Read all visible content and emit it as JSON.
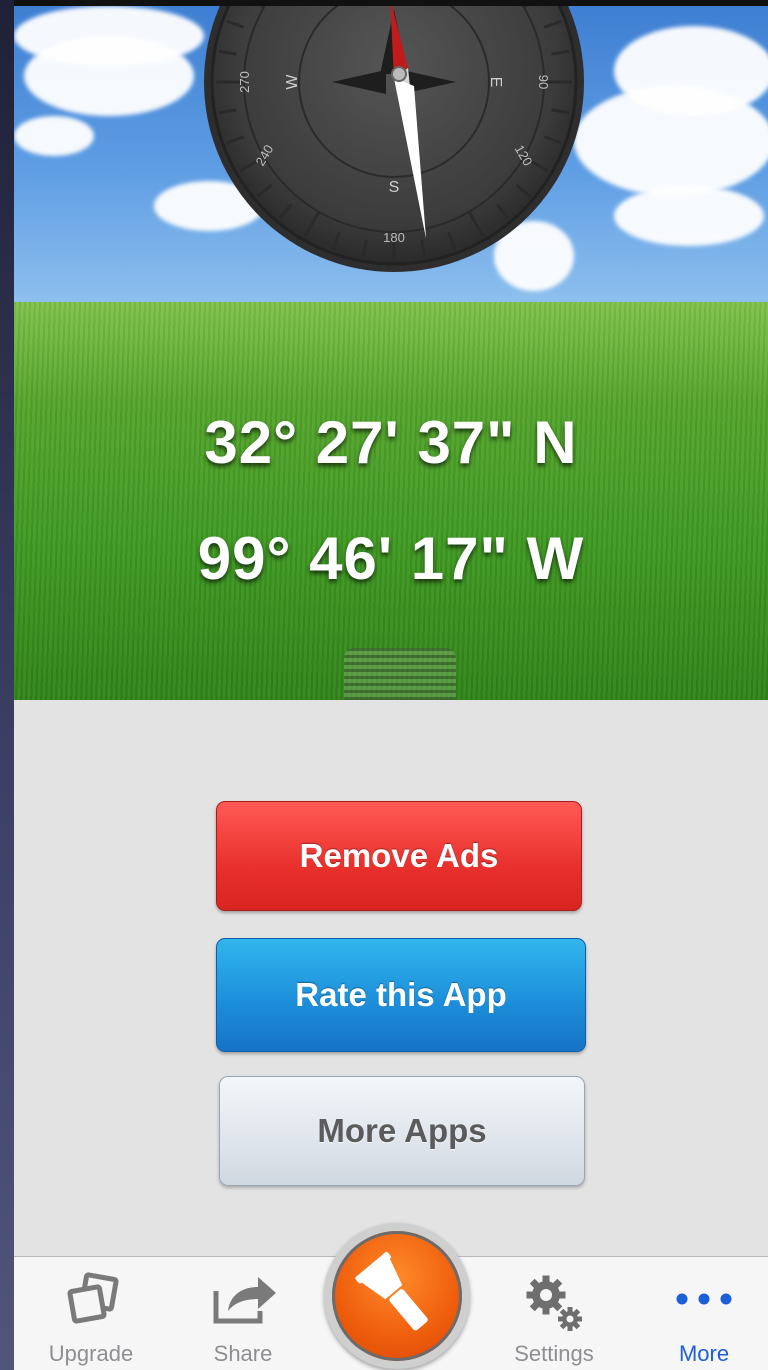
{
  "compass": {
    "cardinals": {
      "west": "W",
      "east": "E",
      "south": "S"
    },
    "degree_labels": {
      "left": "270",
      "right": "90",
      "bottom_left": "240",
      "bottom_right": "120",
      "bottom": "180"
    }
  },
  "location": {
    "latitude": "32° 27' 37\" N",
    "longitude": "99° 46' 17\" W"
  },
  "actions": {
    "remove_ads": "Remove Ads",
    "rate_app": "Rate this App",
    "more_apps": "More Apps"
  },
  "tabbar": {
    "active_tab": "More",
    "accent_color": "#1d5fd8",
    "items": [
      {
        "label": "Upgrade",
        "icon": "upgrade-icon"
      },
      {
        "label": "Share",
        "icon": "share-icon"
      },
      {
        "label": "",
        "icon": "flashlight-icon"
      },
      {
        "label": "Settings",
        "icon": "gear-icon"
      },
      {
        "label": "More",
        "icon": "more-icon"
      }
    ]
  }
}
